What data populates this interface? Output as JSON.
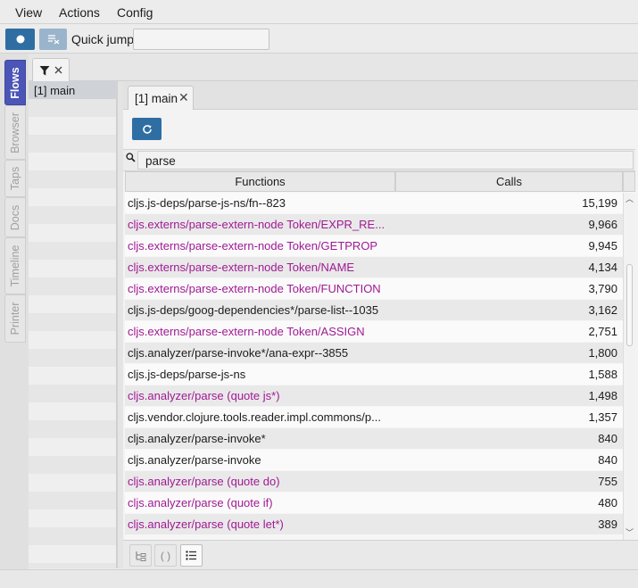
{
  "menu": {
    "items": [
      "View",
      "Actions",
      "Config"
    ]
  },
  "toolbar": {
    "quick_jump_label": "Quick jump:",
    "quick_jump_value": ""
  },
  "sidebar_tabs": [
    {
      "label": "Flows",
      "active": true
    },
    {
      "label": "Browser",
      "active": false
    },
    {
      "label": "Taps",
      "active": false
    },
    {
      "label": "Docs",
      "active": false
    },
    {
      "label": "Timeline",
      "active": false
    },
    {
      "label": "Printer",
      "active": false
    }
  ],
  "flows": {
    "filter_tab_icon": "filter-icon",
    "items": [
      "[1] main"
    ]
  },
  "main_tab": {
    "label": "[1] main"
  },
  "search": {
    "value": "parse"
  },
  "table": {
    "headers": {
      "functions": "Functions",
      "calls": "Calls"
    },
    "rows": [
      {
        "fn": "cljs.js-deps/parse-js-ns/fn--823",
        "calls": "15,199",
        "color": "dark"
      },
      {
        "fn": "cljs.externs/parse-extern-node Token/EXPR_RE...",
        "calls": "9,966",
        "color": "purple"
      },
      {
        "fn": "cljs.externs/parse-extern-node Token/GETPROP",
        "calls": "9,945",
        "color": "purple"
      },
      {
        "fn": "cljs.externs/parse-extern-node Token/NAME",
        "calls": "4,134",
        "color": "purple"
      },
      {
        "fn": "cljs.externs/parse-extern-node Token/FUNCTION",
        "calls": "3,790",
        "color": "purple"
      },
      {
        "fn": "cljs.js-deps/goog-dependencies*/parse-list--1035",
        "calls": "3,162",
        "color": "dark"
      },
      {
        "fn": "cljs.externs/parse-extern-node Token/ASSIGN",
        "calls": "2,751",
        "color": "purple"
      },
      {
        "fn": "cljs.analyzer/parse-invoke*/ana-expr--3855",
        "calls": "1,800",
        "color": "dark"
      },
      {
        "fn": "cljs.js-deps/parse-js-ns",
        "calls": "1,588",
        "color": "dark"
      },
      {
        "fn": "cljs.analyzer/parse (quote js*)",
        "calls": "1,498",
        "color": "purple"
      },
      {
        "fn": "cljs.vendor.clojure.tools.reader.impl.commons/p...",
        "calls": "1,357",
        "color": "dark"
      },
      {
        "fn": "cljs.analyzer/parse-invoke*",
        "calls": "840",
        "color": "dark"
      },
      {
        "fn": "cljs.analyzer/parse-invoke",
        "calls": "840",
        "color": "dark"
      },
      {
        "fn": "cljs.analyzer/parse (quote do)",
        "calls": "755",
        "color": "purple"
      },
      {
        "fn": "cljs.analyzer/parse (quote if)",
        "calls": "480",
        "color": "purple"
      },
      {
        "fn": "cljs.analyzer/parse (quote let*)",
        "calls": "389",
        "color": "purple"
      }
    ]
  },
  "bottom_tools": [
    {
      "icon": "tree-view-icon",
      "selected": false
    },
    {
      "icon": "parens-icon",
      "label": "( )",
      "selected": false
    },
    {
      "icon": "list-view-icon",
      "selected": true
    }
  ],
  "colors": {
    "accent": "#2f6ea3",
    "active_tab": "#4a55b7",
    "purple_text": "#a01a94"
  }
}
